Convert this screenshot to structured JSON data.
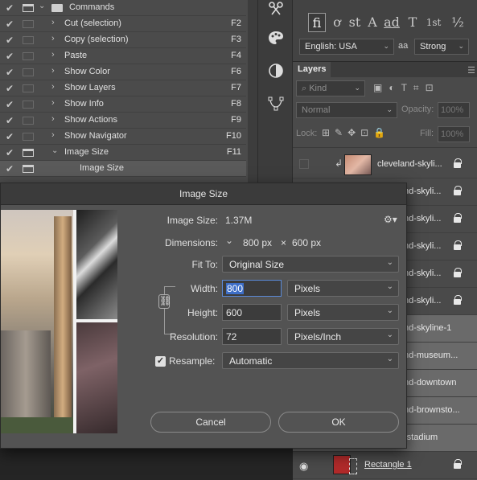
{
  "actions_panel": {
    "rows": [
      {
        "label": "Commands",
        "shortcut": "",
        "folder": true
      },
      {
        "label": "Cut (selection)",
        "shortcut": "F2"
      },
      {
        "label": "Copy (selection)",
        "shortcut": "F3"
      },
      {
        "label": "Paste",
        "shortcut": "F4"
      },
      {
        "label": "Show Color",
        "shortcut": "F6"
      },
      {
        "label": "Show Layers",
        "shortcut": "F7"
      },
      {
        "label": "Show Info",
        "shortcut": "F8"
      },
      {
        "label": "Show Actions",
        "shortcut": "F9"
      },
      {
        "label": "Show Navigator",
        "shortcut": "F10"
      },
      {
        "label": "Image Size",
        "shortcut": "F11"
      },
      {
        "label": "Image Size",
        "shortcut": ""
      }
    ]
  },
  "char_panel": {
    "language": "English: USA",
    "antialias": "Strong",
    "aa_icon": "aa",
    "glyphs": [
      "fi",
      "ơ",
      "st",
      "A",
      "ad",
      "T",
      "1st",
      "½"
    ]
  },
  "layers_panel": {
    "tab_label": "Layers",
    "kind_placeholder": "Kind",
    "blend_mode": "Normal",
    "opacity_label": "Opacity:",
    "opacity_value": "100%",
    "lock_label": "Lock:",
    "fill_label": "Fill:",
    "fill_value": "100%",
    "layers": [
      {
        "name": "cleveland-skyli...",
        "visible": false
      },
      {
        "name": "nd-skyli...",
        "visible": true
      },
      {
        "name": "nd-skyli...",
        "visible": true
      },
      {
        "name": "nd-skyli...",
        "visible": true
      },
      {
        "name": "nd-skyli...",
        "visible": true
      },
      {
        "name": "nd-skyli...",
        "visible": true
      },
      {
        "name": "nd-skyline-1",
        "visible": true
      },
      {
        "name": "nd-museum...",
        "visible": true
      },
      {
        "name": "nd-downtown",
        "visible": true
      },
      {
        "name": "nd-brownsto...",
        "visible": true
      },
      {
        "name": "-stadium",
        "visible": true
      },
      {
        "name": "Rectangle 1",
        "visible": true
      }
    ]
  },
  "dialog": {
    "title": "Image Size",
    "image_size_label": "Image Size:",
    "image_size_value": "1.37M",
    "dimensions_label": "Dimensions:",
    "dimensions_w": "800 px",
    "dimensions_x": "×",
    "dimensions_h": "600 px",
    "fit_to_label": "Fit To:",
    "fit_to_value": "Original Size",
    "width_label": "Width:",
    "width_value": "800",
    "width_unit": "Pixels",
    "height_label": "Height:",
    "height_value": "600",
    "height_unit": "Pixels",
    "resolution_label": "Resolution:",
    "resolution_value": "72",
    "resolution_unit": "Pixels/Inch",
    "resample_label": "Resample:",
    "resample_checked": true,
    "resample_value": "Automatic",
    "cancel_label": "Cancel",
    "ok_label": "OK"
  }
}
